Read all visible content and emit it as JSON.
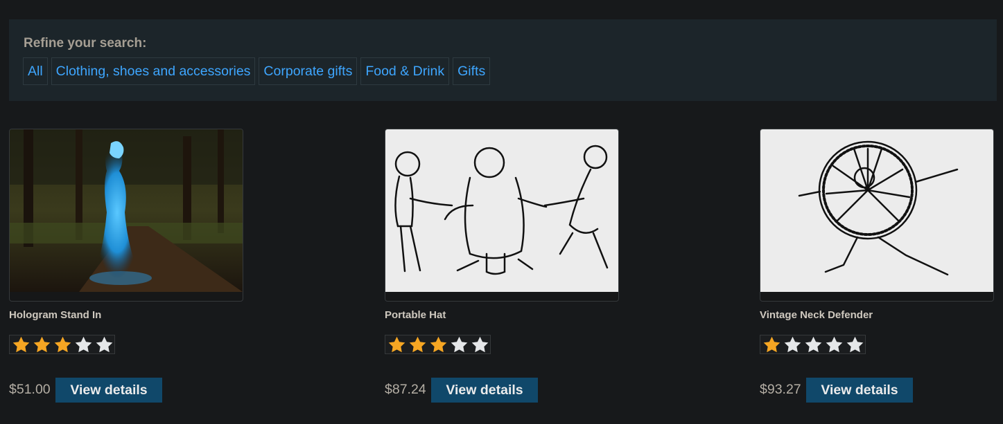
{
  "filters": {
    "title": "Refine your search:",
    "links": [
      "All",
      "Clothing, shoes and accessories",
      "Corporate gifts",
      "Food & Drink",
      "Gifts"
    ]
  },
  "products": [
    {
      "name": "Hologram Stand In",
      "rating": 3,
      "max_rating": 5,
      "price": "$51.00",
      "button_label": "View details"
    },
    {
      "name": "Portable Hat",
      "rating": 3,
      "max_rating": 5,
      "price": "$87.24",
      "button_label": "View details"
    },
    {
      "name": "Vintage Neck Defender",
      "rating": 1,
      "max_rating": 5,
      "price": "$93.27",
      "button_label": "View details"
    }
  ],
  "colors": {
    "background": "#17191b",
    "panel": "#1c252a",
    "link": "#3ea6ff",
    "button": "#10486a",
    "star_filled": "#f6a623",
    "star_empty": "#e5e7e9"
  }
}
